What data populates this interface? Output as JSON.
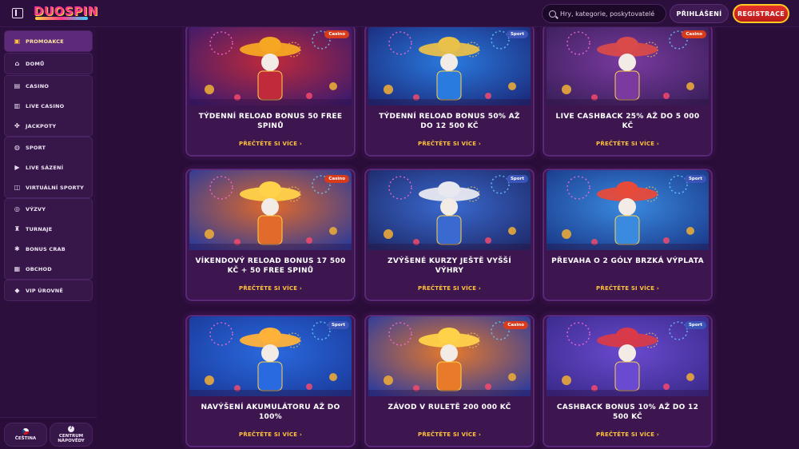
{
  "header": {
    "logo": "DUOSPIN",
    "search_placeholder": "Hry, kategorie, poskytovatelé",
    "login_label": "PŘIHLÁŠENÍ",
    "register_label": "REGISTRACE"
  },
  "sidebar": {
    "groups": [
      [
        {
          "label": "PROMOAKCE",
          "icon": "gift-icon",
          "active": true
        }
      ],
      [
        {
          "label": "DOMŮ",
          "icon": "home-icon"
        }
      ],
      [
        {
          "label": "CASINO",
          "icon": "slot-machine-icon"
        },
        {
          "label": "LIVE CASINO",
          "icon": "cards-icon"
        },
        {
          "label": "JACKPOTY",
          "icon": "clover-icon"
        }
      ],
      [
        {
          "label": "SPORT",
          "icon": "ball-icon"
        },
        {
          "label": "LIVE SÁZENÍ",
          "icon": "play-icon"
        },
        {
          "label": "VIRTUÁLNÍ SPORTY",
          "icon": "gamepad-icon"
        }
      ],
      [
        {
          "label": "VÝZVY",
          "icon": "target-icon"
        },
        {
          "label": "TURNAJE",
          "icon": "trophy-icon"
        },
        {
          "label": "BONUS CRAB",
          "icon": "crab-icon"
        },
        {
          "label": "OBCHOD",
          "icon": "cart-icon"
        }
      ],
      [
        {
          "label": "VIP ÚROVNĚ",
          "icon": "diamond-icon"
        }
      ]
    ],
    "footer": {
      "language_label": "ČEŠTINA",
      "help_label_1": "CENTRUM",
      "help_label_2": "NÁPOVĚDY"
    }
  },
  "promos": [
    {
      "title": "TÝDENNÍ RELOAD BONUS 50 FREE SPINŮ",
      "badge": "Casino",
      "link": "PŘEČTĚTE SI VÍCE ›",
      "colors": [
        "#3a1a6e",
        "#c02a3a",
        "#f5a623"
      ]
    },
    {
      "title": "TÝDENNÍ RELOAD BONUS 50% AŽ DO 12 500 KČ",
      "badge": "Sport",
      "link": "PŘEČTĚTE SI VÍCE ›",
      "colors": [
        "#1b2a7a",
        "#2a7be0",
        "#e8c04a"
      ]
    },
    {
      "title": "LIVE CASHBACK 25% AŽ DO 5 000 KČ",
      "badge": "Casino",
      "link": "PŘEČTĚTE SI VÍCE ›",
      "colors": [
        "#3a1f5a",
        "#7a3aa0",
        "#d94a4a"
      ]
    },
    {
      "title": "VÍKENDOVÝ RELOAD BONUS 17 500 KČ + 50 FREE SPINŮ",
      "badge": "Casino",
      "link": "PŘEČTĚTE SI VÍCE ›",
      "colors": [
        "#2a3a9a",
        "#e26a2a",
        "#ffd24a"
      ]
    },
    {
      "title": "ZVÝŠENÉ KURZY JEŠTĚ VYŠŠÍ VÝHRY",
      "badge": "Sport",
      "link": "PŘEČTĚTE SI VÍCE ›",
      "colors": [
        "#1e2a6a",
        "#3a6ad0",
        "#e8e8f0"
      ]
    },
    {
      "title": "PŘEVAHA O 2 GÓLY BRZKÁ VÝPLATA",
      "badge": "Sport",
      "link": "PŘEČTĚTE SI VÍCE ›",
      "colors": [
        "#1a3a8a",
        "#3a8ae0",
        "#e84a3a"
      ]
    },
    {
      "title": "NAVÝŠENÍ AKUMULÁTORU AŽ DO 100%",
      "badge": "Sport",
      "link": "PŘEČTĚTE SI VÍCE ›",
      "colors": [
        "#1a3a9a",
        "#2a6ae0",
        "#ffb23a"
      ]
    },
    {
      "title": "ZÁVOD V RULETĚ 200 000 KČ",
      "badge": "Casino",
      "link": "PŘEČTĚTE SI VÍCE ›",
      "colors": [
        "#2a3aa0",
        "#e87a2a",
        "#ffd24a"
      ]
    },
    {
      "title": "CASHBACK BONUS 10% AŽ DO 12 500 KČ",
      "badge": "Sport",
      "link": "PŘEČTĚTE SI VÍCE ›",
      "colors": [
        "#3a2a8a",
        "#6a4ad0",
        "#d83a4a"
      ]
    }
  ]
}
